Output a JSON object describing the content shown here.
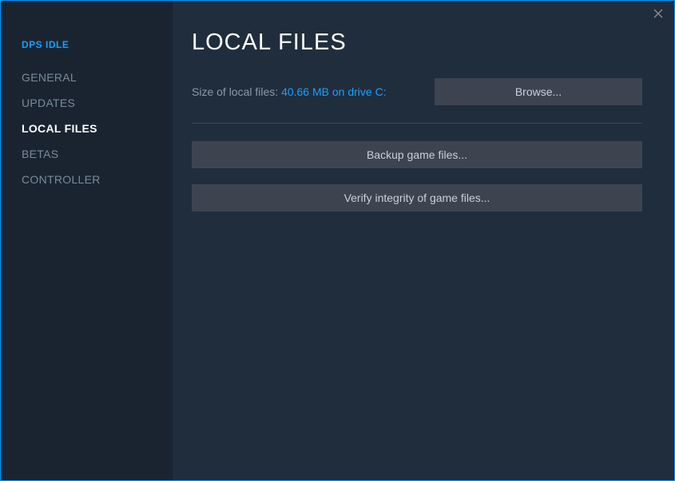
{
  "game_name": "DPS IDLE",
  "sidebar": {
    "items": [
      {
        "label": "GENERAL",
        "active": false
      },
      {
        "label": "UPDATES",
        "active": false
      },
      {
        "label": "LOCAL FILES",
        "active": true
      },
      {
        "label": "BETAS",
        "active": false
      },
      {
        "label": "CONTROLLER",
        "active": false
      }
    ]
  },
  "main": {
    "title": "LOCAL FILES",
    "size_label": "Size of local files: ",
    "size_value": "40.66 MB on drive C:",
    "browse_label": "Browse...",
    "backup_label": "Backup game files...",
    "verify_label": "Verify integrity of game files..."
  }
}
